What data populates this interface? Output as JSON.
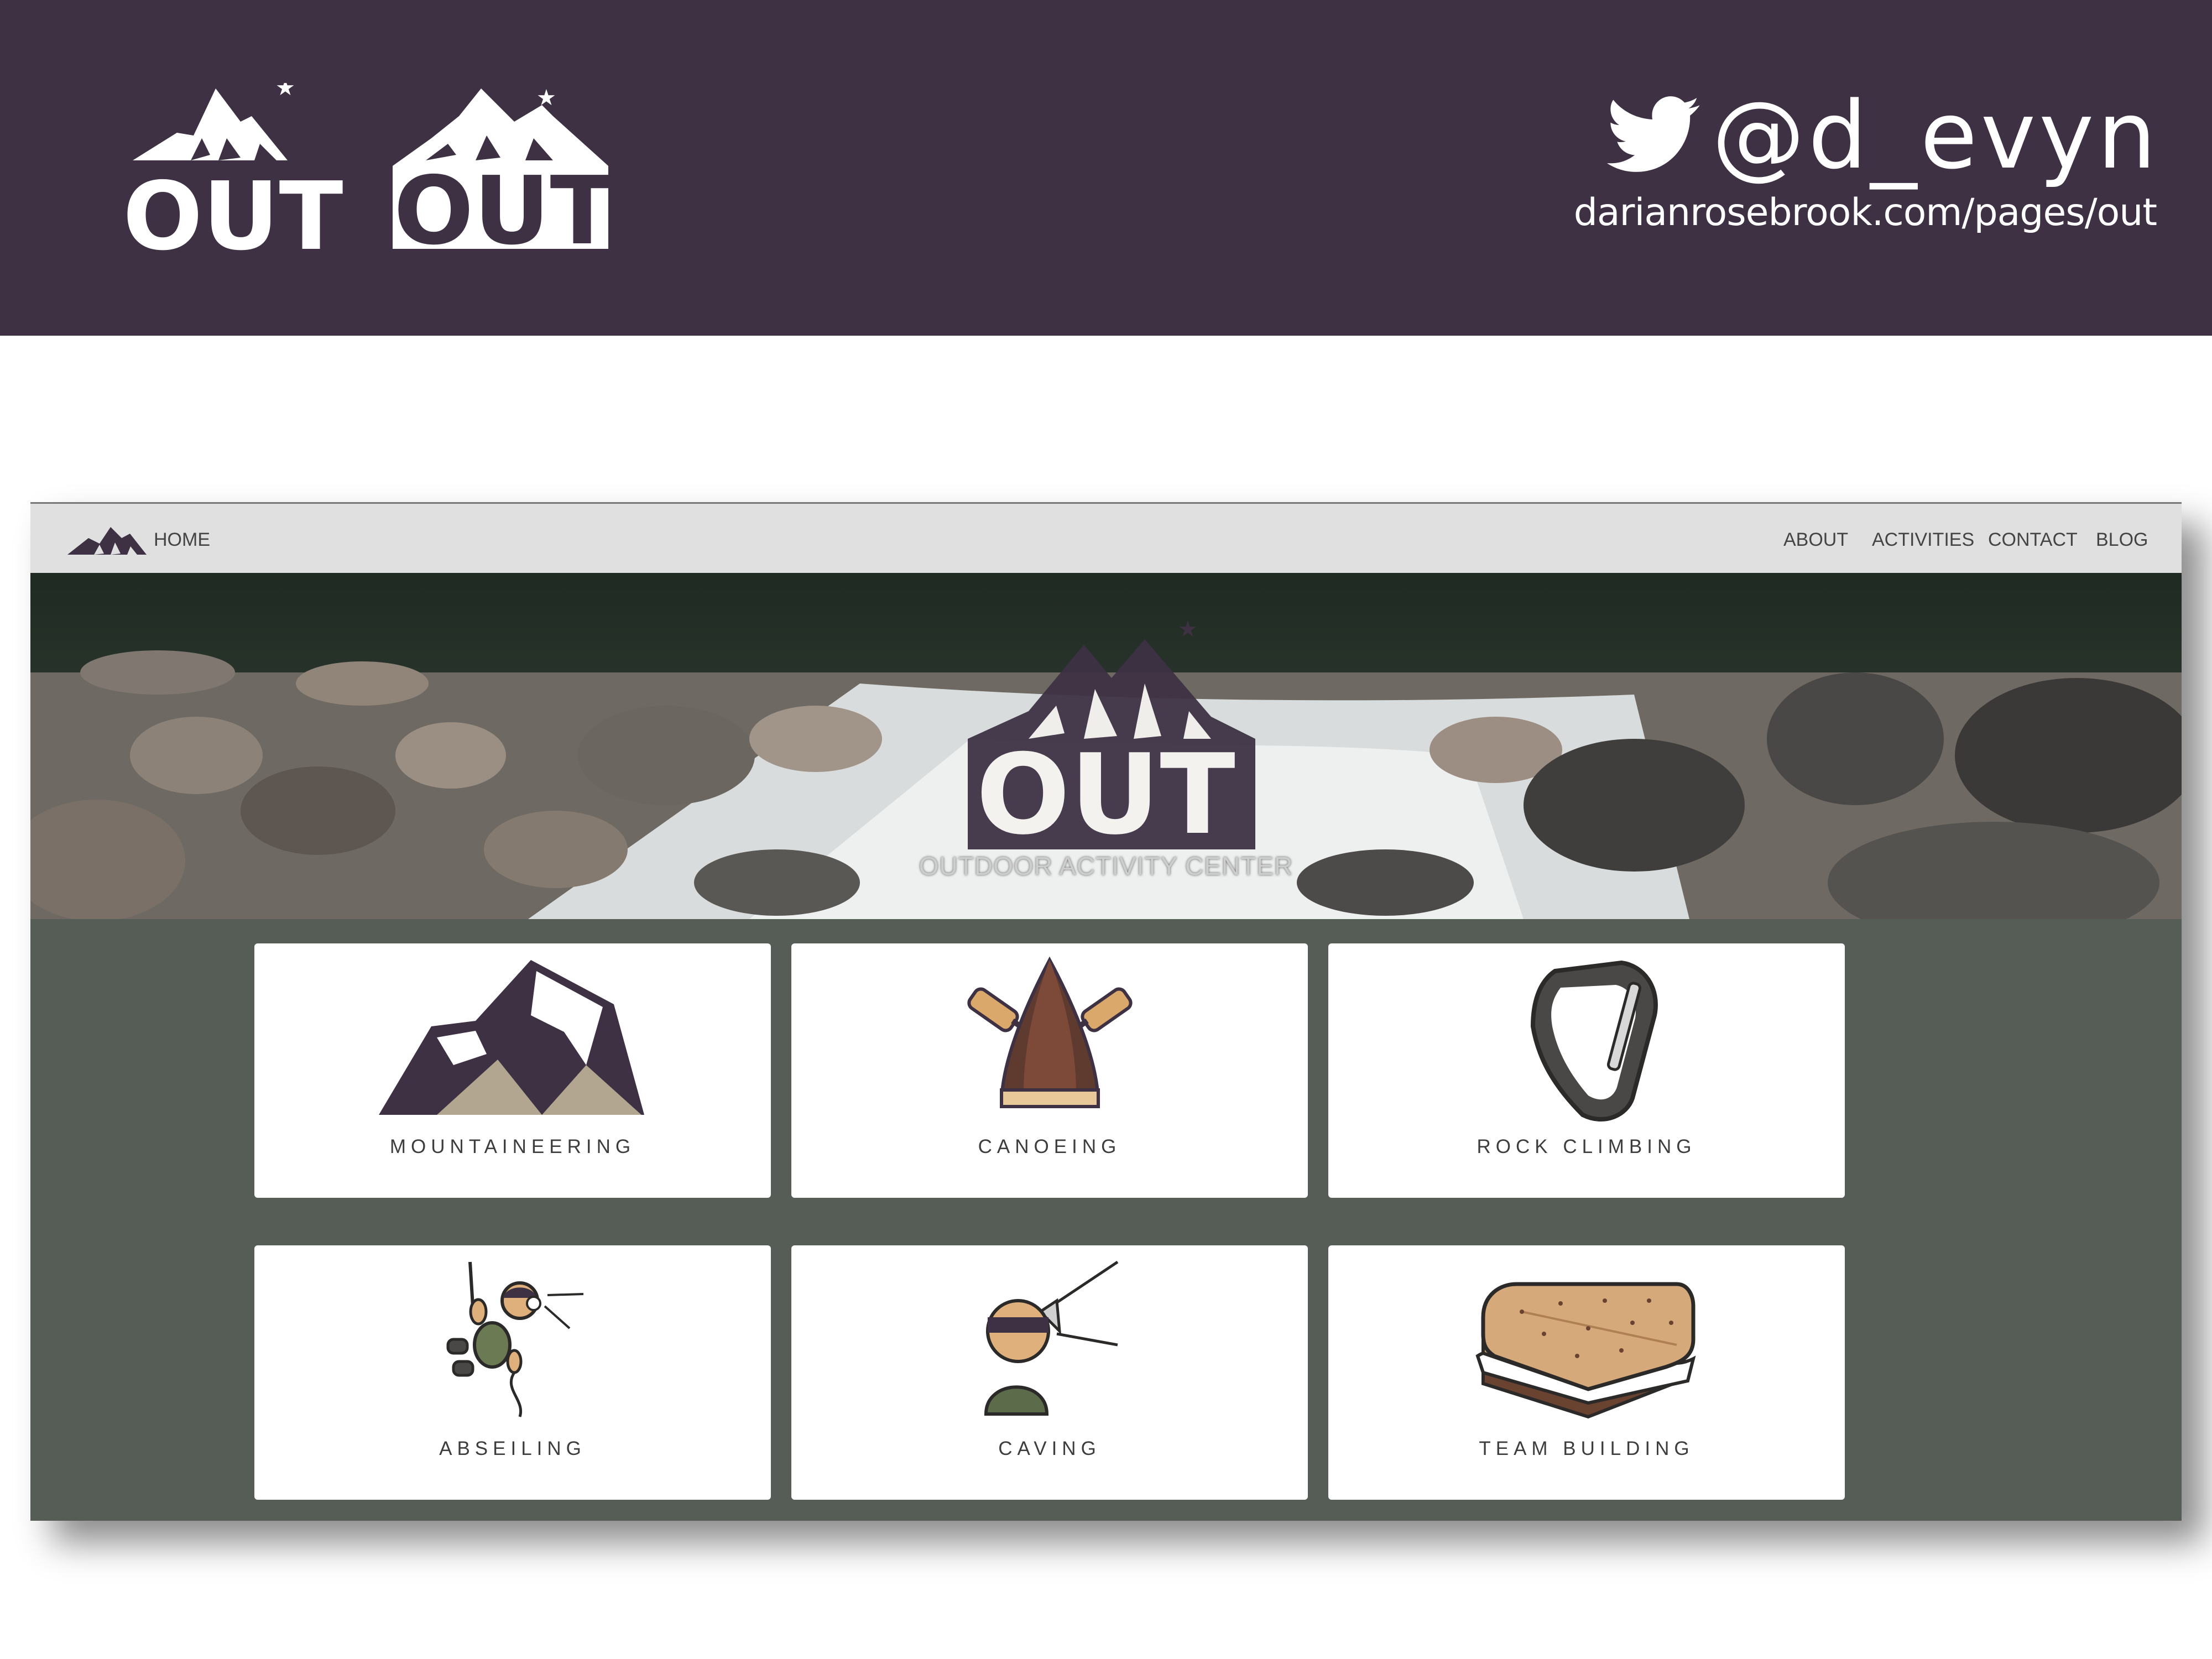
{
  "banner": {
    "logo_outline_text": "OUT",
    "logo_solid_text": "OUT",
    "twitter_handle": "@d_evyn",
    "portfolio_url": "darianrosebrook.com/pages/out",
    "icons": [
      "mountain-logo",
      "twitter-bird-icon"
    ],
    "background": "#3d3143"
  },
  "site": {
    "nav": {
      "home_label": "HOME",
      "items": [
        "ABOUT",
        "ACTIVITIES",
        "CONTACT",
        "BLOG"
      ]
    },
    "hero": {
      "logo_text": "OUT",
      "tagline": "OUTDOOR ACTIVITY CENTER"
    },
    "activities": [
      {
        "label": "MOUNTAINEERING",
        "icon": "mountain-icon"
      },
      {
        "label": "CANOEING",
        "icon": "canoe-icon"
      },
      {
        "label": "ROCK CLIMBING",
        "icon": "carabiner-icon"
      },
      {
        "label": "ABSEILING",
        "icon": "climber-icon"
      },
      {
        "label": "CAVING",
        "icon": "headlamp-caver-icon"
      },
      {
        "label": "TEAM BUILDING",
        "icon": "smore-icon"
      }
    ],
    "colors": {
      "navbar": "#e0e0e0",
      "content_background": "#565c56",
      "brand_plum": "#3d3143",
      "card": "#ffffff"
    }
  }
}
